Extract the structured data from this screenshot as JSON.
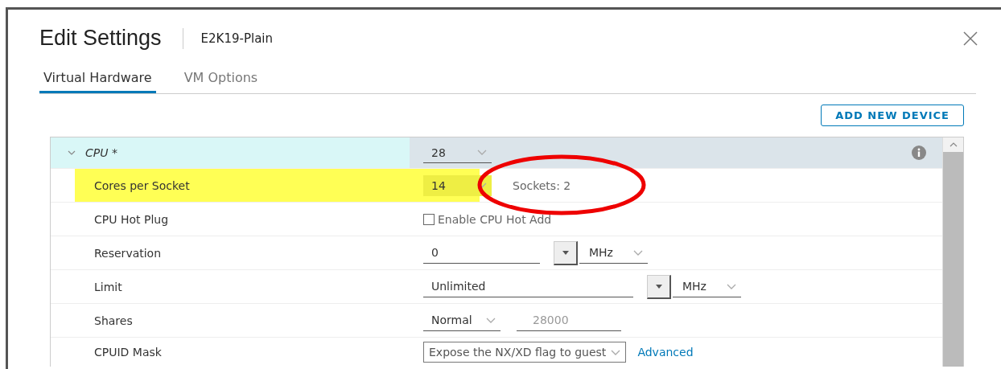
{
  "dialog": {
    "title": "Edit Settings",
    "subtitle": "E2K19-Plain"
  },
  "tabs": [
    {
      "label": "Virtual Hardware",
      "selected": true
    },
    {
      "label": "VM Options",
      "selected": false
    }
  ],
  "add_button": "ADD NEW DEVICE",
  "cpu": {
    "label": "CPU *",
    "expanded": true,
    "value": "28"
  },
  "rows": [
    {
      "kind": "select",
      "label": "Cores per Socket",
      "value": "14",
      "highlighted": true,
      "note": "Sockets: 2"
    },
    {
      "kind": "checkbox",
      "label": "CPU Hot Plug",
      "checkbox_label": "Enable CPU Hot Add",
      "checked": false,
      "highlighted": false
    },
    {
      "kind": "combo_unit",
      "label": "Reservation",
      "value": "0",
      "unit": "MHz",
      "highlighted": false
    },
    {
      "kind": "combo_unit",
      "label": "Limit",
      "value": "Unlimited",
      "unit": "MHz",
      "highlighted": false
    },
    {
      "kind": "select_amount",
      "label": "Shares",
      "value": "Normal",
      "amount": "28000",
      "highlighted": false
    },
    {
      "kind": "mask",
      "label": "CPUID Mask",
      "value": "Expose the NX/XD flag to guest",
      "link": "Advanced",
      "highlighted": false
    }
  ]
}
